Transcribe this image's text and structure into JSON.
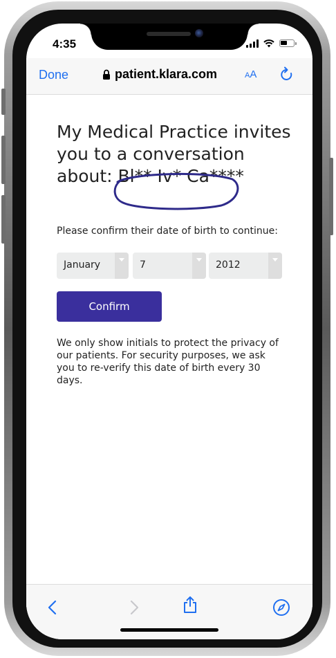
{
  "status_bar": {
    "time": "4:35"
  },
  "browser": {
    "done_label": "Done",
    "url": "patient.klara.com",
    "text_size_label_small": "A",
    "text_size_label_large": "A"
  },
  "page": {
    "headline": "My Medical Practice invites you to a conversation about: Bl** Iv* Ca****",
    "confirm_prompt": "Please confirm their date of birth to continue:",
    "dob": {
      "month": "January",
      "day": "7",
      "year": "2012"
    },
    "confirm_button": "Confirm",
    "privacy_notice": "We only show initials to protect the privacy of our patients. For security purposes, we ask you to re-verify this date of birth every 30 days."
  },
  "colors": {
    "accent_blue": "#1f6ff0",
    "confirm_button_bg": "#3a2f9d",
    "annotation_circle": "#2e2a8a"
  },
  "icons": {
    "toolbar": [
      "back-icon",
      "forward-icon",
      "share-icon",
      "compass-icon"
    ],
    "header": [
      "lock-icon",
      "reload-icon"
    ]
  }
}
